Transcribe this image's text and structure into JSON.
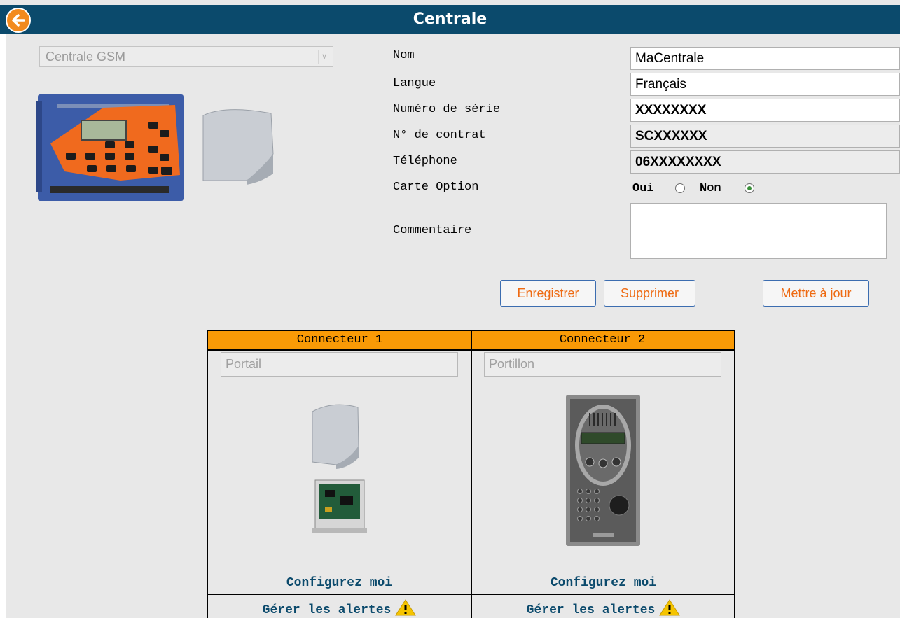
{
  "header": {
    "title": "Centrale"
  },
  "device": {
    "selected": "Centrale GSM"
  },
  "form": {
    "nom_label": "Nom",
    "nom_value": "MaCentrale",
    "langue_label": "Langue",
    "langue_value": "Français",
    "serie_label": "Numéro de série",
    "serie_value": "XXXXXXXX",
    "contrat_label": "N° de contrat",
    "contrat_value": "SCXXXXXX",
    "telephone_label": "Téléphone",
    "telephone_value": "06XXXXXXXX",
    "carte_label": "Carte Option",
    "oui_label": "Oui",
    "non_label": "Non",
    "carte_option_selected": "Non",
    "commentaire_label": "Commentaire"
  },
  "buttons": {
    "save": "Enregistrer",
    "delete": "Supprimer",
    "update": "Mettre à jour"
  },
  "connectors": [
    {
      "title": "Connecteur 1",
      "placeholder": "Portail",
      "config": "Configurez moi",
      "alerts": "Gérer les alertes"
    },
    {
      "title": "Connecteur 2",
      "placeholder": "Portillon",
      "config": "Configurez moi",
      "alerts": "Gérer les alertes"
    }
  ],
  "colors": {
    "header_bg": "#0b4a6c",
    "accent_orange": "#f99a06",
    "button_text": "#ee6a12",
    "link": "#0b4a6c"
  }
}
